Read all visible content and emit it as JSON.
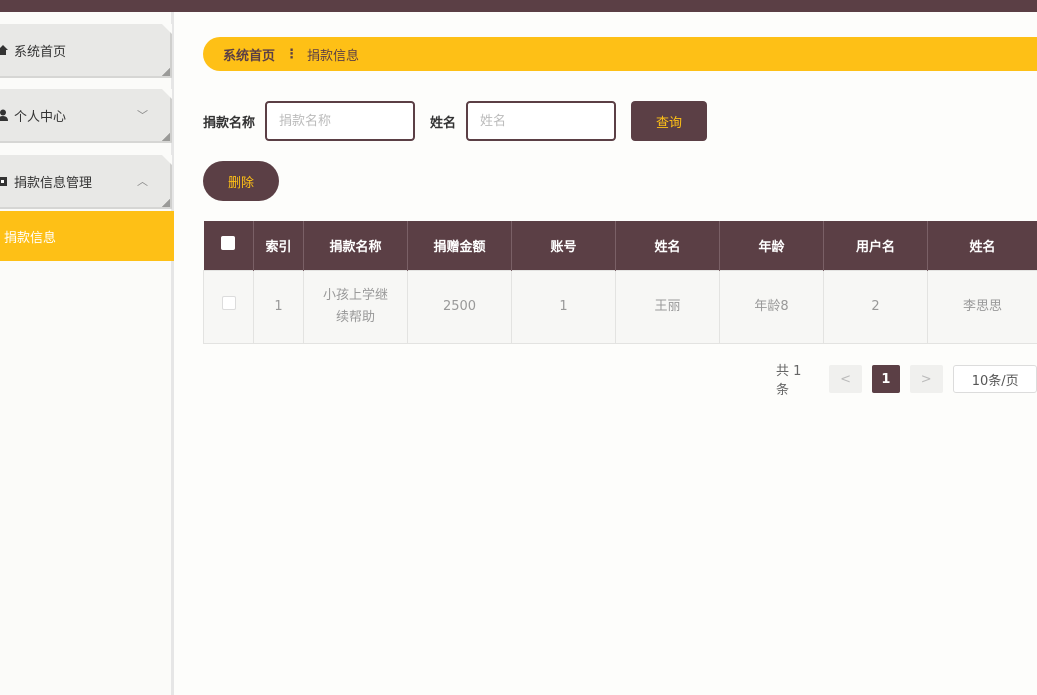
{
  "sidebar": {
    "items": [
      {
        "label": "系统首页",
        "icon": "home-icon"
      },
      {
        "label": "个人中心",
        "icon": "user-icon",
        "arrow": "﹀"
      },
      {
        "label": "捐款信息管理",
        "icon": "box-icon",
        "arrow": "︿"
      }
    ],
    "submenu": {
      "label": "捐款信息"
    }
  },
  "breadcrumb": {
    "home": "系统首页",
    "separator": "⋮",
    "current": "捐款信息"
  },
  "search": {
    "name_label": "捐款名称",
    "name_placeholder": "捐款名称",
    "person_label": "姓名",
    "person_placeholder": "姓名",
    "query_button": "查询"
  },
  "actions": {
    "delete_button": "删除"
  },
  "table": {
    "headers": [
      "索引",
      "捐款名称",
      "捐赠金额",
      "账号",
      "姓名",
      "年龄",
      "用户名",
      "姓名"
    ],
    "rows": [
      {
        "index": "1",
        "name_line1": "小孩上学继",
        "name_line2": "续帮助",
        "amount": "2500",
        "account": "1",
        "person": "王丽",
        "age": "年龄8",
        "username": "2",
        "name2": "李思思"
      }
    ]
  },
  "pagination": {
    "total": "共 1 条",
    "prev": "<",
    "page": "1",
    "next": ">",
    "size": "10条/页"
  },
  "colors": {
    "primary": "#5b3f45",
    "accent": "#fec016"
  }
}
